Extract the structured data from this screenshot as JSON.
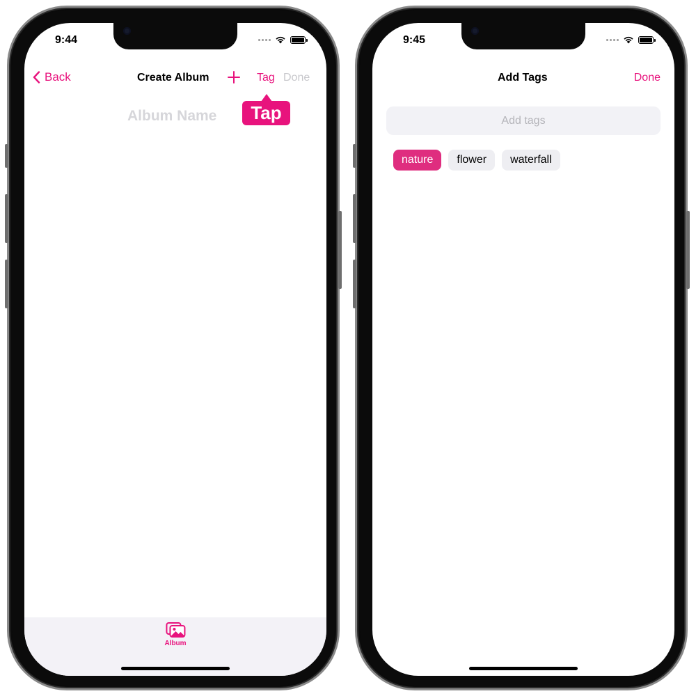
{
  "theme": {
    "accent": "#e8137d",
    "selected_tag": "#df2d7f",
    "tab_bar_bg": "#f3f2f7"
  },
  "left_screen": {
    "status": {
      "time": "9:44"
    },
    "nav": {
      "back_label": "Back",
      "title": "Create Album",
      "add_icon": "plus-icon",
      "tag_label": "Tag",
      "done_label": "Done"
    },
    "album_name_placeholder": "Album Name",
    "callout": {
      "label": "Tap"
    },
    "tab_bar": {
      "items": [
        {
          "label": "Album",
          "icon": "photo-album-icon",
          "selected": true
        }
      ]
    }
  },
  "right_screen": {
    "status": {
      "time": "9:45"
    },
    "nav": {
      "title": "Add Tags",
      "done_label": "Done"
    },
    "search": {
      "placeholder": "Add tags",
      "value": ""
    },
    "tags": [
      {
        "label": "nature",
        "selected": true
      },
      {
        "label": "flower",
        "selected": false
      },
      {
        "label": "waterfall",
        "selected": false
      }
    ]
  }
}
